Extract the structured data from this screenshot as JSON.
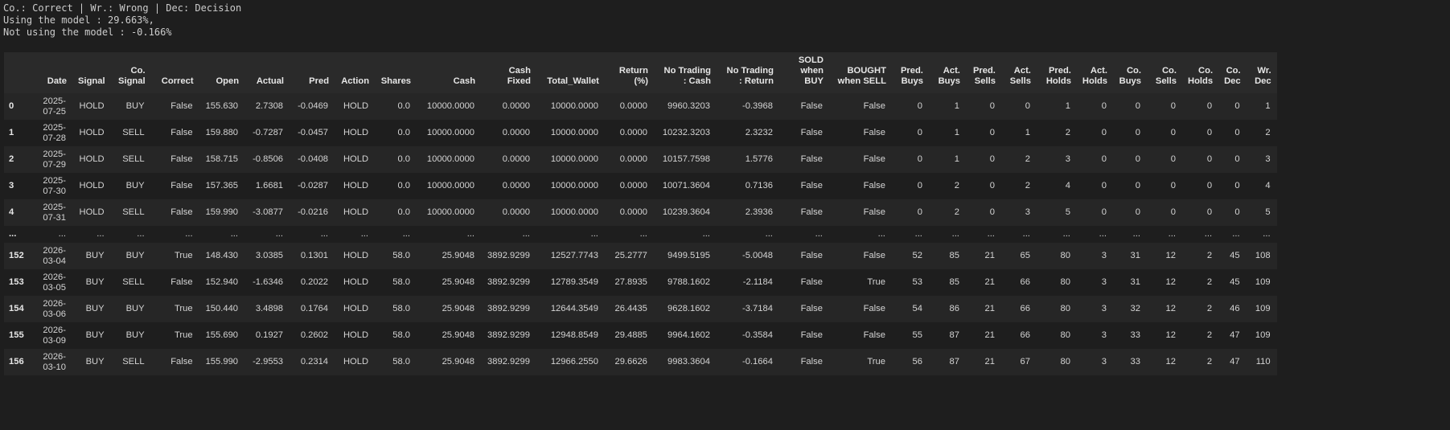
{
  "legend": {
    "line1": "Co.: Correct | Wr.: Wrong | Dec: Decision",
    "line2": "Using the model : 29.663%,",
    "line3": "Not using the model : -0.166%"
  },
  "table": {
    "columns": [
      "",
      "Date",
      "Signal",
      "Co. Signal",
      "Correct",
      "Open",
      "Actual",
      "Pred",
      "Action",
      "Shares",
      "Cash",
      "Cash Fixed",
      "Total_Wallet",
      "Return (%)",
      "No Trading : Cash",
      "No Trading : Return",
      "SOLD when BUY",
      "BOUGHT when SELL",
      "Pred. Buys",
      "Act. Buys",
      "Pred. Sells",
      "Act. Sells",
      "Pred. Holds",
      "Act. Holds",
      "Co. Buys",
      "Co. Sells",
      "Co. Holds",
      "Co. Dec",
      "Wr. Dec"
    ],
    "rows": [
      [
        "0",
        "2025-07-25",
        "HOLD",
        "BUY",
        "False",
        "155.630",
        "2.7308",
        "-0.0469",
        "HOLD",
        "0.0",
        "10000.0000",
        "0.0000",
        "10000.0000",
        "0.0000",
        "9960.3203",
        "-0.3968",
        "False",
        "False",
        "0",
        "1",
        "0",
        "0",
        "1",
        "0",
        "0",
        "0",
        "0",
        "0",
        "1"
      ],
      [
        "1",
        "2025-07-28",
        "HOLD",
        "SELL",
        "False",
        "159.880",
        "-0.7287",
        "-0.0457",
        "HOLD",
        "0.0",
        "10000.0000",
        "0.0000",
        "10000.0000",
        "0.0000",
        "10232.3203",
        "2.3232",
        "False",
        "False",
        "0",
        "1",
        "0",
        "1",
        "2",
        "0",
        "0",
        "0",
        "0",
        "0",
        "2"
      ],
      [
        "2",
        "2025-07-29",
        "HOLD",
        "SELL",
        "False",
        "158.715",
        "-0.8506",
        "-0.0408",
        "HOLD",
        "0.0",
        "10000.0000",
        "0.0000",
        "10000.0000",
        "0.0000",
        "10157.7598",
        "1.5776",
        "False",
        "False",
        "0",
        "1",
        "0",
        "2",
        "3",
        "0",
        "0",
        "0",
        "0",
        "0",
        "3"
      ],
      [
        "3",
        "2025-07-30",
        "HOLD",
        "BUY",
        "False",
        "157.365",
        "1.6681",
        "-0.0287",
        "HOLD",
        "0.0",
        "10000.0000",
        "0.0000",
        "10000.0000",
        "0.0000",
        "10071.3604",
        "0.7136",
        "False",
        "False",
        "0",
        "2",
        "0",
        "2",
        "4",
        "0",
        "0",
        "0",
        "0",
        "0",
        "4"
      ],
      [
        "4",
        "2025-07-31",
        "HOLD",
        "SELL",
        "False",
        "159.990",
        "-3.0877",
        "-0.0216",
        "HOLD",
        "0.0",
        "10000.0000",
        "0.0000",
        "10000.0000",
        "0.0000",
        "10239.3604",
        "2.3936",
        "False",
        "False",
        "0",
        "2",
        "0",
        "3",
        "5",
        "0",
        "0",
        "0",
        "0",
        "0",
        "5"
      ],
      [
        "...",
        "...",
        "...",
        "...",
        "...",
        "...",
        "...",
        "...",
        "...",
        "...",
        "...",
        "...",
        "...",
        "...",
        "...",
        "...",
        "...",
        "...",
        "...",
        "...",
        "...",
        "...",
        "...",
        "...",
        "...",
        "...",
        "...",
        "...",
        "..."
      ],
      [
        "152",
        "2026-03-04",
        "BUY",
        "BUY",
        "True",
        "148.430",
        "3.0385",
        "0.1301",
        "HOLD",
        "58.0",
        "25.9048",
        "3892.9299",
        "12527.7743",
        "25.2777",
        "9499.5195",
        "-5.0048",
        "False",
        "False",
        "52",
        "85",
        "21",
        "65",
        "80",
        "3",
        "31",
        "12",
        "2",
        "45",
        "108"
      ],
      [
        "153",
        "2026-03-05",
        "BUY",
        "SELL",
        "False",
        "152.940",
        "-1.6346",
        "0.2022",
        "HOLD",
        "58.0",
        "25.9048",
        "3892.9299",
        "12789.3549",
        "27.8935",
        "9788.1602",
        "-2.1184",
        "False",
        "True",
        "53",
        "85",
        "21",
        "66",
        "80",
        "3",
        "31",
        "12",
        "2",
        "45",
        "109"
      ],
      [
        "154",
        "2026-03-06",
        "BUY",
        "BUY",
        "True",
        "150.440",
        "3.4898",
        "0.1764",
        "HOLD",
        "58.0",
        "25.9048",
        "3892.9299",
        "12644.3549",
        "26.4435",
        "9628.1602",
        "-3.7184",
        "False",
        "False",
        "54",
        "86",
        "21",
        "66",
        "80",
        "3",
        "32",
        "12",
        "2",
        "46",
        "109"
      ],
      [
        "155",
        "2026-03-09",
        "BUY",
        "BUY",
        "True",
        "155.690",
        "0.1927",
        "0.2602",
        "HOLD",
        "58.0",
        "25.9048",
        "3892.9299",
        "12948.8549",
        "29.4885",
        "9964.1602",
        "-0.3584",
        "False",
        "False",
        "55",
        "87",
        "21",
        "66",
        "80",
        "3",
        "33",
        "12",
        "2",
        "47",
        "109"
      ],
      [
        "156",
        "2026-03-10",
        "BUY",
        "SELL",
        "False",
        "155.990",
        "-2.9553",
        "0.2314",
        "HOLD",
        "58.0",
        "25.9048",
        "3892.9299",
        "12966.2550",
        "29.6626",
        "9983.3604",
        "-0.1664",
        "False",
        "True",
        "56",
        "87",
        "21",
        "67",
        "80",
        "3",
        "33",
        "12",
        "2",
        "47",
        "110"
      ]
    ]
  }
}
